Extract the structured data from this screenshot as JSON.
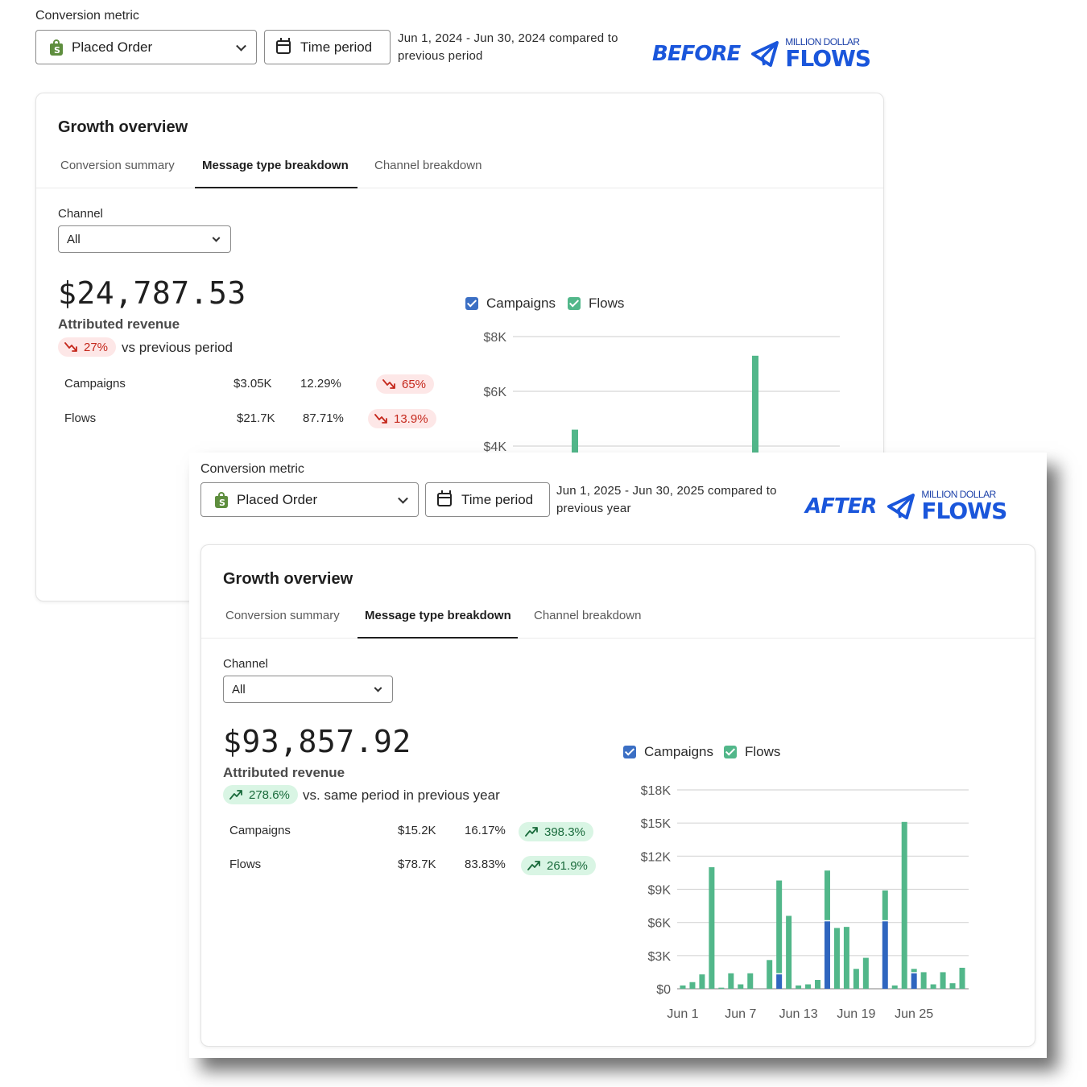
{
  "colors": {
    "campaigns": "#2f66bf",
    "flows": "#52b78a",
    "brand": "#1a56db",
    "down": "#c5281c",
    "up": "#1a6b3c"
  },
  "before": {
    "brand_tag": "BEFORE",
    "conversion_metric_label": "Conversion metric",
    "metric_select": "Placed Order",
    "time_period_button": "Time period",
    "date_line1": "Jun 1, 2024 - Jun 30, 2024 compared to",
    "date_line2": "previous period",
    "card": {
      "title": "Growth overview",
      "tabs": [
        "Conversion summary",
        "Message type breakdown",
        "Channel breakdown"
      ],
      "channel_label": "Channel",
      "channel_select": "All",
      "total": "$24,787.53",
      "total_label": "Attributed revenue",
      "change": "27%",
      "change_text": "vs previous period",
      "rows": [
        {
          "name": "Campaigns",
          "value": "$3.05K",
          "share": "12.29%",
          "change": "65%"
        },
        {
          "name": "Flows",
          "value": "$21.7K",
          "share": "87.71%",
          "change": "13.9%"
        }
      ],
      "legend": [
        "Campaigns",
        "Flows"
      ]
    }
  },
  "after": {
    "brand_tag": "AFTER",
    "conversion_metric_label": "Conversion metric",
    "metric_select": "Placed Order",
    "time_period_button": "Time period",
    "date_line1": "Jun 1, 2025 - Jun 30, 2025 compared to",
    "date_line2": "previous year",
    "card": {
      "title": "Growth overview",
      "tabs": [
        "Conversion summary",
        "Message type breakdown",
        "Channel breakdown"
      ],
      "channel_label": "Channel",
      "channel_select": "All",
      "total": "$93,857.92",
      "total_label": "Attributed revenue",
      "change": "278.6%",
      "change_text": "vs. same period in previous year",
      "rows": [
        {
          "name": "Campaigns",
          "value": "$15.2K",
          "share": "16.17%",
          "change": "398.3%"
        },
        {
          "name": "Flows",
          "value": "$78.7K",
          "share": "83.83%",
          "change": "261.9%"
        }
      ],
      "legend": [
        "Campaigns",
        "Flows"
      ]
    }
  },
  "brand": {
    "small": "MILLION DOLLAR",
    "big": "FLOWS"
  },
  "chart_data": [
    {
      "type": "bar",
      "stacked": true,
      "y_ticks": [
        "$4K",
        "$6K",
        "$8K"
      ],
      "ylim": [
        3000,
        8000
      ],
      "visible_range_note": "",
      "categories": [
        "Jun 1",
        "Jun 2",
        "Jun 3",
        "Jun 4",
        "Jun 5",
        "Jun 6",
        "Jun 7",
        "Jun 8",
        "Jun 9",
        "Jun 10",
        "Jun 11",
        "Jun 12",
        "Jun 13",
        "Jun 14",
        "Jun 15",
        "Jun 16",
        "Jun 17",
        "Jun 18",
        "Jun 19",
        "Jun 20",
        "Jun 21",
        "Jun 22",
        "Jun 23",
        "Jun 24",
        "Jun 25",
        "Jun 26",
        "Jun 27",
        "Jun 28",
        "Jun 29",
        "Jun 30"
      ],
      "series": [
        {
          "name": "Campaigns",
          "values": [
            0,
            0,
            0,
            0,
            0,
            0,
            0,
            0,
            0,
            0,
            0,
            0,
            0,
            0,
            0,
            0,
            0,
            0,
            0,
            0,
            0,
            0,
            0,
            0,
            0,
            0,
            0,
            0,
            0,
            0
          ]
        },
        {
          "name": "Flows",
          "values": [
            0,
            0,
            0,
            0,
            0,
            0,
            0,
            0,
            0,
            0,
            0,
            0,
            4600,
            0,
            0,
            0,
            0,
            0,
            0,
            0,
            0,
            0,
            0,
            0,
            0,
            0,
            7300,
            0,
            0,
            0
          ]
        }
      ]
    },
    {
      "type": "bar",
      "stacked": true,
      "y_ticks": [
        "$0",
        "$3K",
        "$6K",
        "$9K",
        "$12K",
        "$15K",
        "$18K"
      ],
      "ylim": [
        0,
        18000
      ],
      "x_ticks": [
        "Jun 1",
        "Jun 7",
        "Jun 13",
        "Jun 19",
        "Jun 25"
      ],
      "categories": [
        "Jun 1",
        "Jun 2",
        "Jun 3",
        "Jun 4",
        "Jun 5",
        "Jun 6",
        "Jun 7",
        "Jun 8",
        "Jun 9",
        "Jun 10",
        "Jun 11",
        "Jun 12",
        "Jun 13",
        "Jun 14",
        "Jun 15",
        "Jun 16",
        "Jun 17",
        "Jun 18",
        "Jun 19",
        "Jun 20",
        "Jun 21",
        "Jun 22",
        "Jun 23",
        "Jun 24",
        "Jun 25",
        "Jun 26",
        "Jun 27",
        "Jun 28",
        "Jun 29",
        "Jun 30"
      ],
      "series": [
        {
          "name": "Campaigns",
          "values": [
            0,
            0,
            0,
            0,
            0,
            0,
            0,
            0,
            0,
            0,
            1300,
            0,
            0,
            0,
            0,
            6100,
            0,
            0,
            0,
            0,
            0,
            6100,
            0,
            0,
            1400,
            0,
            0,
            0,
            0,
            0
          ]
        },
        {
          "name": "Flows",
          "values": [
            300,
            600,
            1300,
            11000,
            100,
            1400,
            400,
            1400,
            0,
            2600,
            8500,
            6600,
            300,
            400,
            800,
            4600,
            5500,
            5600,
            1800,
            2800,
            0,
            2800,
            300,
            15100,
            400,
            1500,
            400,
            1500,
            500,
            1900
          ]
        }
      ]
    }
  ]
}
